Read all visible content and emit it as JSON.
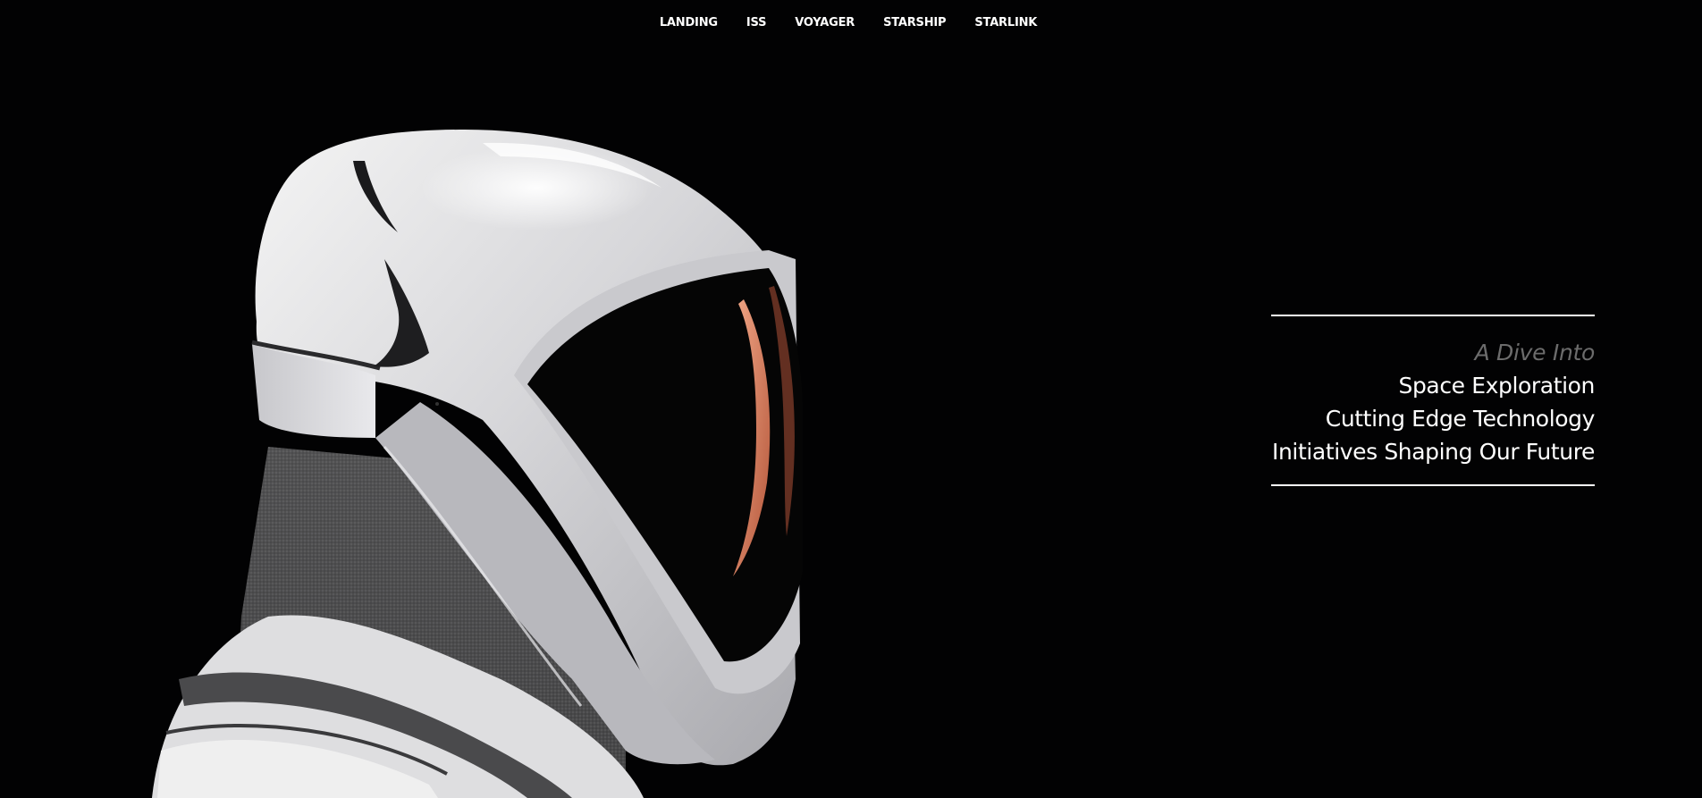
{
  "nav": {
    "items": [
      {
        "label": "LANDING"
      },
      {
        "label": "ISS"
      },
      {
        "label": "VOYAGER"
      },
      {
        "label": "STARSHIP"
      },
      {
        "label": "STARLINK"
      }
    ]
  },
  "hero": {
    "image_subject": "astronaut-helmet",
    "tagline": {
      "intro": "A Dive Into",
      "lines": [
        "Space Exploration",
        "Cutting Edge Technology",
        "Initiatives Shaping Our Future"
      ]
    }
  },
  "colors": {
    "background": "#020203",
    "nav_text": "#ffffff",
    "intro_text": "#6c6c6c",
    "tagline_text": "#ffffff",
    "rule": "#ffffff",
    "visor_glow": "#e08a6a"
  }
}
